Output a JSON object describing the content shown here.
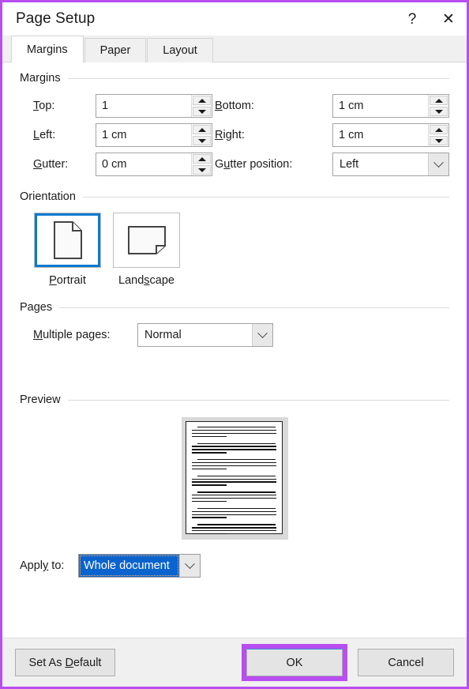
{
  "window": {
    "title": "Page Setup",
    "help_icon": "question-mark-icon",
    "close_icon": "close-icon"
  },
  "tabs": [
    {
      "label": "Margins",
      "active": true
    },
    {
      "label": "Paper",
      "active": false
    },
    {
      "label": "Layout",
      "active": false
    }
  ],
  "margins": {
    "group_label": "Margins",
    "top": {
      "label": "Top:",
      "accel": "T",
      "value": "1"
    },
    "bottom": {
      "label": "Bottom:",
      "accel": "B",
      "value": "1 cm"
    },
    "left": {
      "label": "Left:",
      "accel": "L",
      "value": "1 cm"
    },
    "right": {
      "label": "Right:",
      "accel": "R",
      "value": "1 cm"
    },
    "gutter": {
      "label": "Gutter:",
      "accel": "G",
      "value": "0 cm"
    },
    "gutter_position": {
      "label": "Gutter position:",
      "accel": "u",
      "value": "Left"
    }
  },
  "orientation": {
    "group_label": "Orientation",
    "portrait": {
      "label": "Portrait",
      "accel": "P",
      "selected": true
    },
    "landscape": {
      "label": "Landscape",
      "accel": "s",
      "selected": false
    }
  },
  "pages": {
    "group_label": "Pages",
    "multiple_pages": {
      "label": "Multiple pages:",
      "accel": "M",
      "value": "Normal"
    }
  },
  "preview": {
    "group_label": "Preview"
  },
  "apply_to": {
    "label": "Apply to:",
    "accel": "y",
    "value": "Whole document"
  },
  "footer": {
    "set_as_default": "Set As Default",
    "set_as_default_accel": "D",
    "ok": "OK",
    "cancel": "Cancel"
  },
  "colors": {
    "annotation": "#b84ef0",
    "selection_blue": "#0b63ce",
    "orientation_selected": "#0b7ad1"
  }
}
